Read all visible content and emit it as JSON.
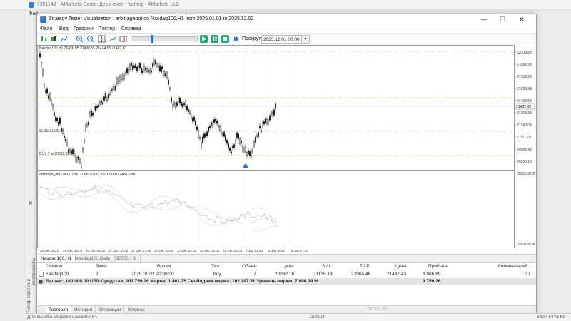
{
  "parent_window": {
    "title": "7351142 - AMarkets-Demo: Демо-счет - Netting - AMarkets LLC",
    "menu_label": "Фай",
    "status_text": "Для вызова справки нажмите F1",
    "status_default": "Default",
    "status_size": "689 / 8448 Kb"
  },
  "window": {
    "title": "Strategy Tester Visualization : arbitragebot on Nasdaq100,H1 from 2025.01.01 to 2025.12.02",
    "controls": {
      "minimize": "—",
      "maximize": "☐",
      "close": "✕"
    }
  },
  "menu": {
    "file": "Файл",
    "view": "Вид",
    "charts": "Графики",
    "tester": "Тестер",
    "help": "Справка"
  },
  "toolbar": {
    "scroll_to_label": "Прокрутить до",
    "scroll_to_value": "2025.12.01 00:00",
    "dropdown_glyph": "▾"
  },
  "chart": {
    "header": "Nasdaq100,H1 21436.95 21438.55 21424.55 21437.43",
    "price_labels": [
      "22009.88",
      "21881.58",
      "21753.29",
      "21624.99",
      "21496.68",
      "21368.38",
      "21240.08",
      "21111.70",
      "20983.48",
      "20855.18"
    ],
    "current_price": "21437.43",
    "sl_label": "SL 5b  21139.18",
    "buy_label": "BUY 7 at 20882.16",
    "indicator_header": "arbitrage_ind -2416.1700 -2435.0200 -2501.5000 -2488.2600",
    "indicator_labels": [
      "-2159.9072",
      "-2560.8528"
    ],
    "time_labels": [
      "30 Dec 2024",
      "19 Dec 14:00",
      "20 Dec 05:00",
      "27 Dec 10:00",
      "27 Dec 17:00",
      "27 Dec 18:00",
      "27 Dec 22:00",
      "30 Dec 13:00",
      "31 Dec 02:00",
      "2 Jan 04:00",
      "3 Jan 05:00",
      "6 Jan 07:00"
    ],
    "colors": {
      "candle": "#1a1a1a",
      "sl_line": "#d9534f",
      "buy_line": "#3a9b3a",
      "level_line": "#c8b45a",
      "indicator": "#444444"
    }
  },
  "chart_tabs": [
    "Nasdaq100,H1",
    "Nasdaq100,Daily",
    "SE500,H1"
  ],
  "positions": {
    "headers": {
      "symbol": "Символ",
      "ticket": "Тикет",
      "time": "Время",
      "type": "Тип",
      "volume": "Объем",
      "price": "Цена",
      "sl": "S / L",
      "tp": "T / P",
      "price2": "Цена",
      "profit": "Прибыль",
      "comment": "Комментарий"
    },
    "rows": [
      {
        "symbol": "nasdaq100",
        "ticket": "2",
        "time": "2025.01.02 20:00:00",
        "type": "buy",
        "volume": "7",
        "price": "20882.16",
        "sl": "21139.18",
        "tp": "22004.46",
        "price2": "21437.43",
        "profit": "3 886.89",
        "comment": "0 /"
      }
    ],
    "balance_line": "Баланс: 100 000.00 USD  Средства: 103 759.26  Маржа: 1 461.75  Свободная маржа: 102 297.51  Уровень маржи: 7 098.29 %",
    "total_profit": "3 759.26"
  },
  "bottom_tabs": [
    "Торговля",
    "История",
    "Операции",
    "Журнал"
  ],
  "side_panel": {
    "close": "✕",
    "label1": "Тестер стратегий",
    "label2": "Инструменты"
  },
  "taskbar_time": "00:02:35"
}
